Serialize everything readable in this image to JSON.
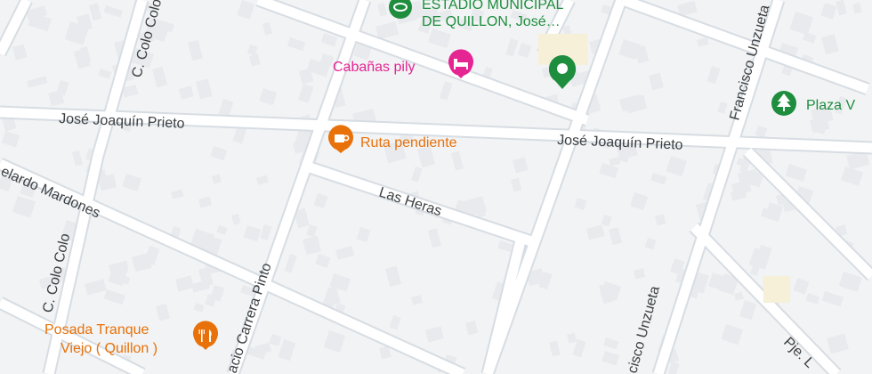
{
  "map": {
    "streets": [
      {
        "id": "jose-joaquin-prieto-west",
        "name": "José Joaquín Prieto"
      },
      {
        "id": "jose-joaquin-prieto-east",
        "name": "José Joaquín Prieto"
      },
      {
        "id": "las-heras",
        "name": "Las Heras"
      },
      {
        "id": "c-colo-colo-north",
        "name": "C. Colo Colo"
      },
      {
        "id": "c-colo-colo-south",
        "name": "C. Colo Colo"
      },
      {
        "id": "abelardo-mardones",
        "name": "elardo Mardones"
      },
      {
        "id": "ignacio-carrera-pinto",
        "name": "acio Carrera Pinto"
      },
      {
        "id": "francisco-unzueta-north",
        "name": "Francisco Unzueta"
      },
      {
        "id": "francisco-unzueta-south",
        "name": "cisco Unzueta"
      },
      {
        "id": "pje",
        "name": "Pje. L"
      }
    ],
    "pois": [
      {
        "id": "estadio",
        "name_line1": "ESTADIO MUNICIPAL",
        "name_line2": "DE QUILLON, José…",
        "icon": "stadium-icon",
        "color": "#1e8e3e"
      },
      {
        "id": "cabanas",
        "name": "Cabañas pily",
        "icon": "bed-icon",
        "color": "#e52592"
      },
      {
        "id": "green-marker",
        "name": "",
        "icon": "place-marker-icon",
        "color": "#1e8e3e"
      },
      {
        "id": "plaza",
        "name": "Plaza V",
        "icon": "tree-icon",
        "color": "#1e8e3e"
      },
      {
        "id": "ruta-pendiente",
        "name": "Ruta pendiente",
        "icon": "coffee-icon",
        "color": "#e8710a"
      },
      {
        "id": "posada",
        "name_line1": "Posada Tranque",
        "name_line2": "Viejo ( Quillon )",
        "icon": "restaurant-icon",
        "color": "#e8710a"
      }
    ],
    "colors": {
      "background": "#f1f3f4",
      "road": "#ffffff",
      "road_edge": "#d7dde3",
      "building": "#e8eaed",
      "street_text": "#3c4043"
    }
  }
}
